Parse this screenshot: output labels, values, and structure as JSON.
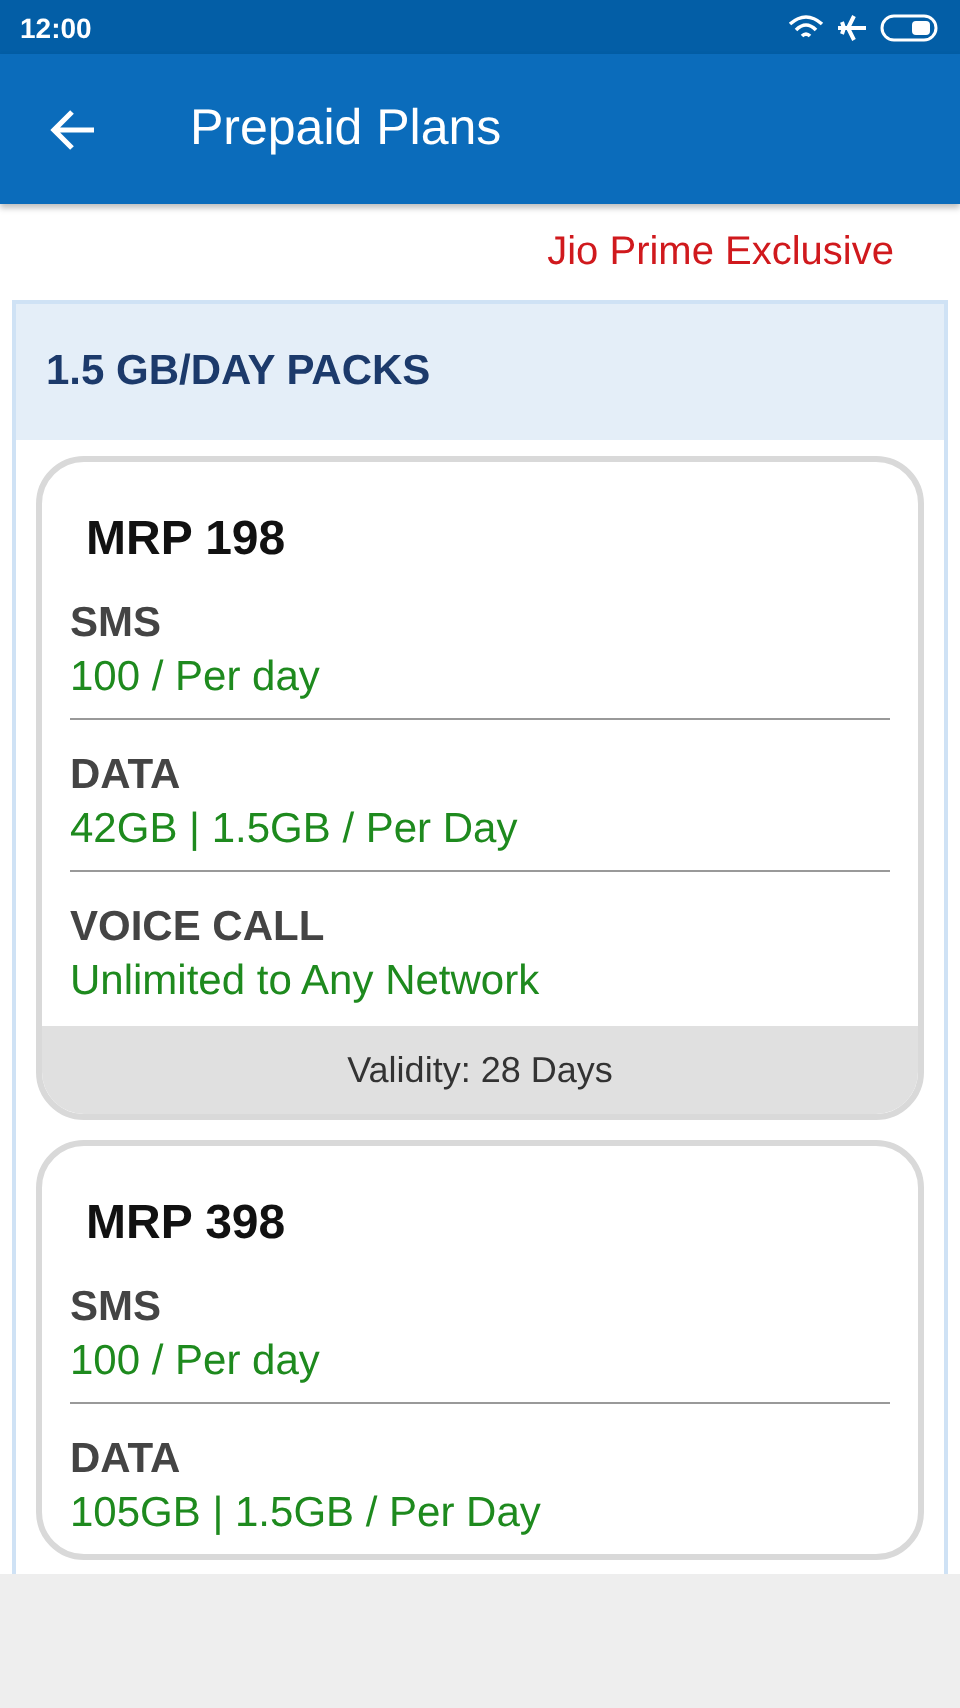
{
  "status_bar": {
    "time": "12:00"
  },
  "app_bar": {
    "title": "Prepaid Plans"
  },
  "badge": "Jio Prime Exclusive",
  "section": {
    "title": "1.5 GB/DAY PACKS"
  },
  "plans": [
    {
      "mrp": "MRP 198",
      "rows": [
        {
          "label": "SMS",
          "value": "100 / Per day"
        },
        {
          "label": "DATA",
          "value": "42GB | 1.5GB / Per Day"
        },
        {
          "label": "VOICE CALL",
          "value": "Unlimited to Any Network"
        }
      ],
      "validity": "Validity: 28 Days"
    },
    {
      "mrp": "MRP 398",
      "rows": [
        {
          "label": "SMS",
          "value": "100 / Per day"
        },
        {
          "label": "DATA",
          "value": "105GB | 1.5GB / Per Day"
        }
      ]
    }
  ]
}
